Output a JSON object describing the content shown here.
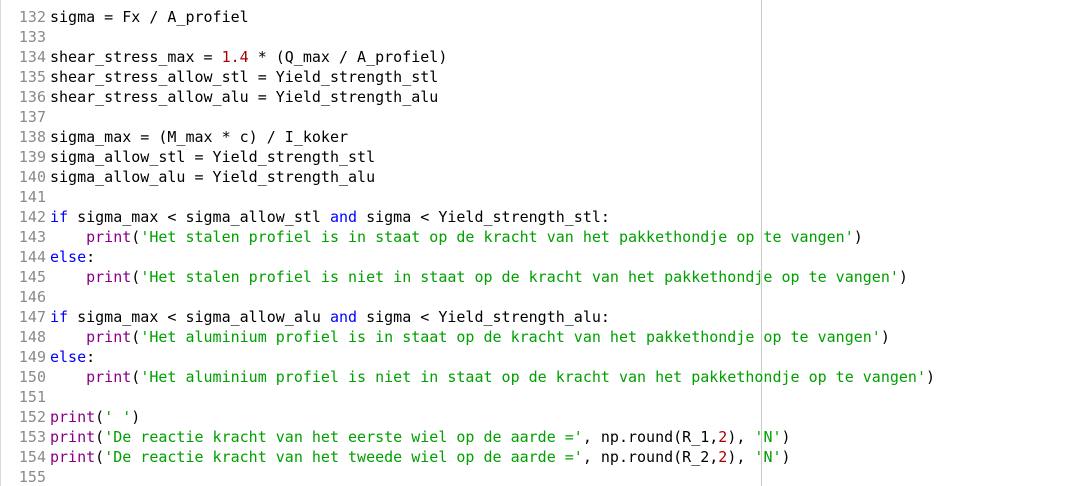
{
  "editor": {
    "lines": [
      {
        "number": "132",
        "tokens": [
          {
            "t": "sigma = Fx / A_profiel",
            "k": "plain"
          }
        ]
      },
      {
        "number": "133",
        "tokens": []
      },
      {
        "number": "134",
        "tokens": [
          {
            "t": "shear_stress_max = ",
            "k": "plain"
          },
          {
            "t": "1.4",
            "k": "num"
          },
          {
            "t": " * (Q_max / A_profiel)",
            "k": "plain"
          }
        ]
      },
      {
        "number": "135",
        "tokens": [
          {
            "t": "shear_stress_allow_stl = Yield_strength_stl",
            "k": "plain"
          }
        ]
      },
      {
        "number": "136",
        "tokens": [
          {
            "t": "shear_stress_allow_alu = Yield_strength_alu",
            "k": "plain"
          }
        ]
      },
      {
        "number": "137",
        "tokens": []
      },
      {
        "number": "138",
        "tokens": [
          {
            "t": "sigma_max = (M_max * c) / I_koker",
            "k": "plain"
          }
        ]
      },
      {
        "number": "139",
        "tokens": [
          {
            "t": "sigma_allow_stl = Yield_strength_stl",
            "k": "plain"
          }
        ]
      },
      {
        "number": "140",
        "tokens": [
          {
            "t": "sigma_allow_alu = Yield_strength_alu",
            "k": "plain"
          }
        ]
      },
      {
        "number": "141",
        "tokens": []
      },
      {
        "number": "142",
        "tokens": [
          {
            "t": "if",
            "k": "kw"
          },
          {
            "t": " sigma_max < sigma_allow_stl ",
            "k": "plain"
          },
          {
            "t": "and",
            "k": "kw"
          },
          {
            "t": " sigma < Yield_strength_stl:",
            "k": "plain"
          }
        ]
      },
      {
        "number": "143",
        "tokens": [
          {
            "t": "    ",
            "k": "plain"
          },
          {
            "t": "print",
            "k": "fn"
          },
          {
            "t": "(",
            "k": "plain"
          },
          {
            "t": "'Het stalen profiel is in staat op de kracht van het pakkethondje op te vangen'",
            "k": "str"
          },
          {
            "t": ")",
            "k": "plain"
          }
        ]
      },
      {
        "number": "144",
        "tokens": [
          {
            "t": "else",
            "k": "kw"
          },
          {
            "t": ":",
            "k": "plain"
          }
        ]
      },
      {
        "number": "145",
        "tokens": [
          {
            "t": "    ",
            "k": "plain"
          },
          {
            "t": "print",
            "k": "fn"
          },
          {
            "t": "(",
            "k": "plain"
          },
          {
            "t": "'Het stalen profiel is niet in staat op de kracht van het pakkethondje op te vangen'",
            "k": "str"
          },
          {
            "t": ")",
            "k": "plain"
          }
        ]
      },
      {
        "number": "146",
        "tokens": []
      },
      {
        "number": "147",
        "tokens": [
          {
            "t": "if",
            "k": "kw"
          },
          {
            "t": " sigma_max < sigma_allow_alu ",
            "k": "plain"
          },
          {
            "t": "and",
            "k": "kw"
          },
          {
            "t": " sigma < Yield_strength_alu:",
            "k": "plain"
          }
        ]
      },
      {
        "number": "148",
        "tokens": [
          {
            "t": "    ",
            "k": "plain"
          },
          {
            "t": "print",
            "k": "fn"
          },
          {
            "t": "(",
            "k": "plain"
          },
          {
            "t": "'Het aluminium profiel is in staat op de kracht van het pakkethondje op te vangen'",
            "k": "str"
          },
          {
            "t": ")",
            "k": "plain"
          }
        ]
      },
      {
        "number": "149",
        "tokens": [
          {
            "t": "else",
            "k": "kw"
          },
          {
            "t": ":",
            "k": "plain"
          }
        ]
      },
      {
        "number": "150",
        "tokens": [
          {
            "t": "    ",
            "k": "plain"
          },
          {
            "t": "print",
            "k": "fn"
          },
          {
            "t": "(",
            "k": "plain"
          },
          {
            "t": "'Het aluminium profiel is niet in staat op de kracht van het pakkethondje op te vangen'",
            "k": "str"
          },
          {
            "t": ")",
            "k": "plain"
          }
        ]
      },
      {
        "number": "151",
        "tokens": []
      },
      {
        "number": "152",
        "tokens": [
          {
            "t": "print",
            "k": "fn"
          },
          {
            "t": "(",
            "k": "plain"
          },
          {
            "t": "' '",
            "k": "str"
          },
          {
            "t": ")",
            "k": "plain"
          }
        ]
      },
      {
        "number": "153",
        "tokens": [
          {
            "t": "print",
            "k": "fn"
          },
          {
            "t": "(",
            "k": "plain"
          },
          {
            "t": "'De reactie kracht van het eerste wiel op de aarde ='",
            "k": "str"
          },
          {
            "t": ", np.round(R_1,",
            "k": "plain"
          },
          {
            "t": "2",
            "k": "num"
          },
          {
            "t": "), ",
            "k": "plain"
          },
          {
            "t": "'N'",
            "k": "str"
          },
          {
            "t": ")",
            "k": "plain"
          }
        ]
      },
      {
        "number": "154",
        "tokens": [
          {
            "t": "print",
            "k": "fn"
          },
          {
            "t": "(",
            "k": "plain"
          },
          {
            "t": "'De reactie kracht van het tweede wiel op de aarde ='",
            "k": "str"
          },
          {
            "t": ", np.round(R_2,",
            "k": "plain"
          },
          {
            "t": "2",
            "k": "num"
          },
          {
            "t": "), ",
            "k": "plain"
          },
          {
            "t": "'N'",
            "k": "str"
          },
          {
            "t": ")",
            "k": "plain"
          }
        ]
      },
      {
        "number": "155",
        "tokens": []
      }
    ]
  },
  "colors": {
    "keyword": "#0000ff",
    "builtin": "#880088",
    "string": "#00a000",
    "number": "#aa0000",
    "line_number": "#8a8a8a",
    "text": "#000000"
  }
}
